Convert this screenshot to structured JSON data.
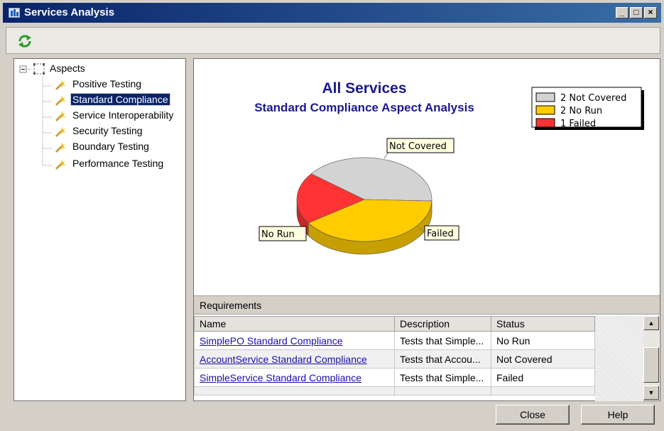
{
  "window": {
    "title": "Services Analysis",
    "controls": {
      "minimize": "_",
      "maximize": "□",
      "close": "×"
    }
  },
  "toolbar": {
    "refresh_icon": "refresh-icon"
  },
  "tree": {
    "root": "Aspects",
    "items": [
      {
        "label": "Positive Testing",
        "selected": false
      },
      {
        "label": "Standard Compliance",
        "selected": true
      },
      {
        "label": "Service Interoperability",
        "selected": false
      },
      {
        "label": "Security Testing",
        "selected": false
      },
      {
        "label": "Boundary Testing",
        "selected": false
      },
      {
        "label": "Performance Testing",
        "selected": false
      }
    ]
  },
  "chart_data": {
    "type": "pie",
    "title": "All Services",
    "subtitle": "Standard Compliance Aspect Analysis",
    "slices": [
      {
        "label": "Not Covered",
        "value": 2,
        "color": "#d3d3d3"
      },
      {
        "label": "No Run",
        "value": 2,
        "color": "#ffcc00"
      },
      {
        "label": "Failed",
        "value": 1,
        "color": "#ff3333"
      }
    ],
    "legend": [
      {
        "count": "2",
        "label": "Not Covered"
      },
      {
        "count": "2",
        "label": "No Run"
      },
      {
        "count": "1",
        "label": "Failed"
      }
    ],
    "legend_position": "top-right",
    "title_color": "#1a1a8c"
  },
  "requirements": {
    "header": "Requirements",
    "columns": [
      "Name",
      "Description",
      "Status"
    ],
    "rows": [
      {
        "name": "SimplePO Standard Compliance",
        "description": "Tests that Simple...",
        "status": "No Run"
      },
      {
        "name": "AccountService Standard Compliance",
        "description": "Tests that Accou...",
        "status": "Not Covered"
      },
      {
        "name": "SimpleService Standard Compliance",
        "description": "Tests that Simple...",
        "status": "Failed"
      }
    ]
  },
  "buttons": {
    "close": "Close",
    "help": "Help"
  }
}
